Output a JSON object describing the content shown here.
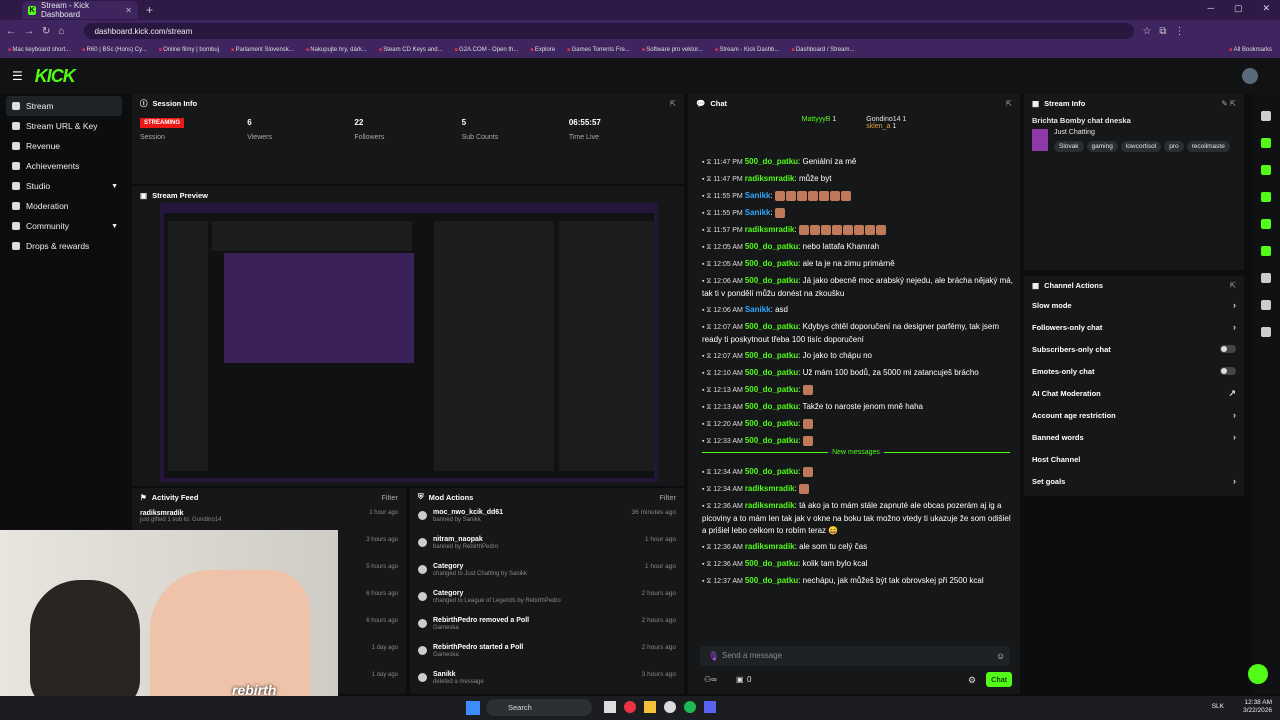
{
  "browser": {
    "tab_title": "Stream - Kick Dashboard",
    "url": "dashboard.kick.com/stream",
    "bookmarks": [
      "Mac keyboard short...",
      "R60 | BSc (Hons) Cy...",
      "Online filmy | bombuj",
      "Parlament Slovensk...",
      "Nakupujte hry, dárk...",
      "Steam CD Keys and...",
      "G2A.COM - Open th...",
      "Explore",
      "Games Torrents Fre...",
      "Software pro vektor...",
      "Stream - Kick Dashb...",
      "Dashboard / Stream..."
    ],
    "all_bookmarks": "All Bookmarks"
  },
  "brand": {
    "logo": "KICK",
    "accent": "#53fc18"
  },
  "sidebar": {
    "items": [
      {
        "label": "Stream",
        "icon": "broadcast-icon",
        "active": true
      },
      {
        "label": "Stream URL & Key",
        "icon": "key-icon"
      },
      {
        "label": "Revenue",
        "icon": "dollar-icon"
      },
      {
        "label": "Achievements",
        "icon": "trophy-icon"
      },
      {
        "label": "Studio",
        "icon": "studio-icon",
        "expand": true
      },
      {
        "label": "Moderation",
        "icon": "sword-icon"
      },
      {
        "label": "Community",
        "icon": "users-icon",
        "expand": true
      },
      {
        "label": "Drops & rewards",
        "icon": "gift-icon"
      }
    ]
  },
  "session": {
    "title": "Session Info",
    "status": "STREAMING",
    "session_label": "Session",
    "stats": [
      {
        "value": "6",
        "label": "Viewers"
      },
      {
        "value": "22",
        "label": "Followers"
      },
      {
        "value": "5",
        "label": "Sub Counts"
      },
      {
        "value": "06:55:57",
        "label": "Time Live"
      }
    ]
  },
  "preview": {
    "title": "Stream Preview"
  },
  "activity": {
    "title": "Activity Feed",
    "filter": "Filter",
    "rows": [
      {
        "name": "radiksmradik",
        "sub": "just gifted 1 sub to: Gondino14",
        "time": "1 hour ago"
      },
      {
        "name": "",
        "sub": "",
        "time": "3 hours ago"
      },
      {
        "name": "",
        "sub": "",
        "time": "5 hours ago"
      },
      {
        "name": "",
        "sub": "",
        "time": "6 hours ago"
      },
      {
        "name": "",
        "sub": "",
        "time": "6 hours ago"
      },
      {
        "name": "",
        "sub": "",
        "time": "1 day ago"
      },
      {
        "name": "",
        "sub": "",
        "time": "1 day ago"
      }
    ]
  },
  "mod": {
    "title": "Mod Actions",
    "filter": "Filter",
    "rows": [
      {
        "title": "moc_nwo_kcik_dd61",
        "sub": "banned by Sanikk",
        "time": "36 minutes ago"
      },
      {
        "title": "nitram_naopak",
        "sub": "banned by RebirthPedro",
        "time": "1 hour ago"
      },
      {
        "title": "Category",
        "sub": "changed to Just Chatting by Sanikk",
        "time": "1 hour ago"
      },
      {
        "title": "Category",
        "sub": "changed to League of Legends by RebirthPedro",
        "time": "2 hours ago"
      },
      {
        "title": "RebirthPedro removed a Poll",
        "sub": "Gameska",
        "time": "2 hours ago"
      },
      {
        "title": "RebirthPedro started a Poll",
        "sub": "Gameska",
        "time": "2 hours ago"
      },
      {
        "title": "Sanikk",
        "sub": "deleted a message",
        "time": "3 hours ago"
      }
    ]
  },
  "chat": {
    "title": "Chat",
    "top_gifters": [
      {
        "name": "MattyyyB",
        "count": "1"
      },
      {
        "name": "Gondino14",
        "count": "1"
      },
      {
        "name": "sklen_a",
        "count": "1"
      }
    ],
    "messages": [
      {
        "time": "11:47 PM",
        "user": "500_do_patku",
        "color": "green",
        "text": "Geniální za mě"
      },
      {
        "time": "11:47 PM",
        "user": "radiksmradik",
        "color": "green",
        "text": "může byt"
      },
      {
        "time": "11:55 PM",
        "user": "Sanikk",
        "color": "blue",
        "text": "",
        "emotes": 7
      },
      {
        "time": "11:55 PM",
        "user": "Sanikk",
        "color": "blue",
        "text": "",
        "emotes": 1
      },
      {
        "time": "11:57 PM",
        "user": "radiksmradik",
        "color": "green",
        "text": "",
        "emotes": 8
      },
      {
        "time": "12:05 AM",
        "user": "500_do_patku",
        "color": "green",
        "text": "nebo lattafa Khamrah"
      },
      {
        "time": "12:05 AM",
        "user": "500_do_patku",
        "color": "green",
        "text": "ale ta je na zimu primárně"
      },
      {
        "time": "12:06 AM",
        "user": "500_do_patku",
        "color": "green",
        "text": "Já jako obecně moc arabský nejedu, ale brácha nějaký má, tak ti v pondělí můžu donést na zkoušku"
      },
      {
        "time": "12:06 AM",
        "user": "Sanikk",
        "color": "blue",
        "text": "asd"
      },
      {
        "time": "12:07 AM",
        "user": "500_do_patku",
        "color": "green",
        "text": "Kdybys chtěl doporučení na designer parfémy, tak jsem ready ti poskytnout třeba 100 tisíc doporučení"
      },
      {
        "time": "12:07 AM",
        "user": "500_do_patku",
        "color": "green",
        "text": "Jo jako to chápu no"
      },
      {
        "time": "12:10 AM",
        "user": "500_do_patku",
        "color": "green",
        "text": "Už mám 100 bodů, za 5000 mi zatancuješ brácho"
      },
      {
        "time": "12:13 AM",
        "user": "500_do_patku",
        "color": "green",
        "text": "",
        "emotes": 1
      },
      {
        "time": "12:13 AM",
        "user": "500_do_patku",
        "color": "green",
        "text": "Takže to naroste jenom mně haha"
      },
      {
        "time": "12:20 AM",
        "user": "500_do_patku",
        "color": "green",
        "text": "",
        "emotes": 1
      },
      {
        "time": "12:33 AM",
        "user": "500_do_patku",
        "color": "green",
        "text": "",
        "emotes": 1
      }
    ],
    "new_messages": "New messages",
    "new": [
      {
        "time": "12:34 AM",
        "user": "500_do_patku",
        "color": "green",
        "text": "",
        "emotes": 1
      },
      {
        "time": "12:34 AM",
        "user": "radiksmradik",
        "color": "green",
        "text": "",
        "emotes": 1
      },
      {
        "time": "12:36 AM",
        "user": "radiksmradik",
        "color": "green",
        "text": "tá ako ja to mám stále zapnuté ale obcas pozerám aj ig a picoviny a to mám len tak jak v okne na boku tak možno vtedy ti ukazuje že som odišiel a prišiel lebo celkom to robím teraz 😄"
      },
      {
        "time": "12:36 AM",
        "user": "radiksmradik",
        "color": "green",
        "text": "ale som tu celý čas"
      },
      {
        "time": "12:36 AM",
        "user": "500_do_patku",
        "color": "green",
        "text": "kolik tam bylo kcal"
      },
      {
        "time": "12:37 AM",
        "user": "500_do_patku",
        "color": "green",
        "text": "nechápu, jak můžeš být tak obrovskej při 2500 kcal"
      }
    ],
    "placeholder": "Send a message",
    "points": "0",
    "send": "Chat"
  },
  "stream_info": {
    "title": "Stream Info",
    "stream_title": "Brichta Bomby chat dneska",
    "category": "Just Chatting",
    "tags": [
      "Slovak",
      "gaming",
      "lowcortisol",
      "pro",
      "recoilmaste"
    ]
  },
  "channel_actions": {
    "title": "Channel Actions",
    "items": [
      {
        "label": "Slow mode",
        "kind": "chevron"
      },
      {
        "label": "Followers-only chat",
        "kind": "chevron"
      },
      {
        "label": "Subscribers-only chat",
        "kind": "toggle"
      },
      {
        "label": "Emotes-only chat",
        "kind": "toggle"
      },
      {
        "label": "AI Chat Moderation",
        "kind": "link"
      },
      {
        "label": "Account age restriction",
        "kind": "chevron"
      },
      {
        "label": "Banned words",
        "kind": "chevron"
      },
      {
        "label": "Host Channel",
        "kind": "none"
      },
      {
        "label": "Set goals",
        "kind": "chevron"
      }
    ]
  },
  "webcam": {
    "brand_top": "rebirth",
    "brand_bottom": "pedro"
  },
  "taskbar": {
    "search": "Search",
    "lang": "SLK",
    "time": "12:38 AM",
    "date": "3/22/2026"
  }
}
